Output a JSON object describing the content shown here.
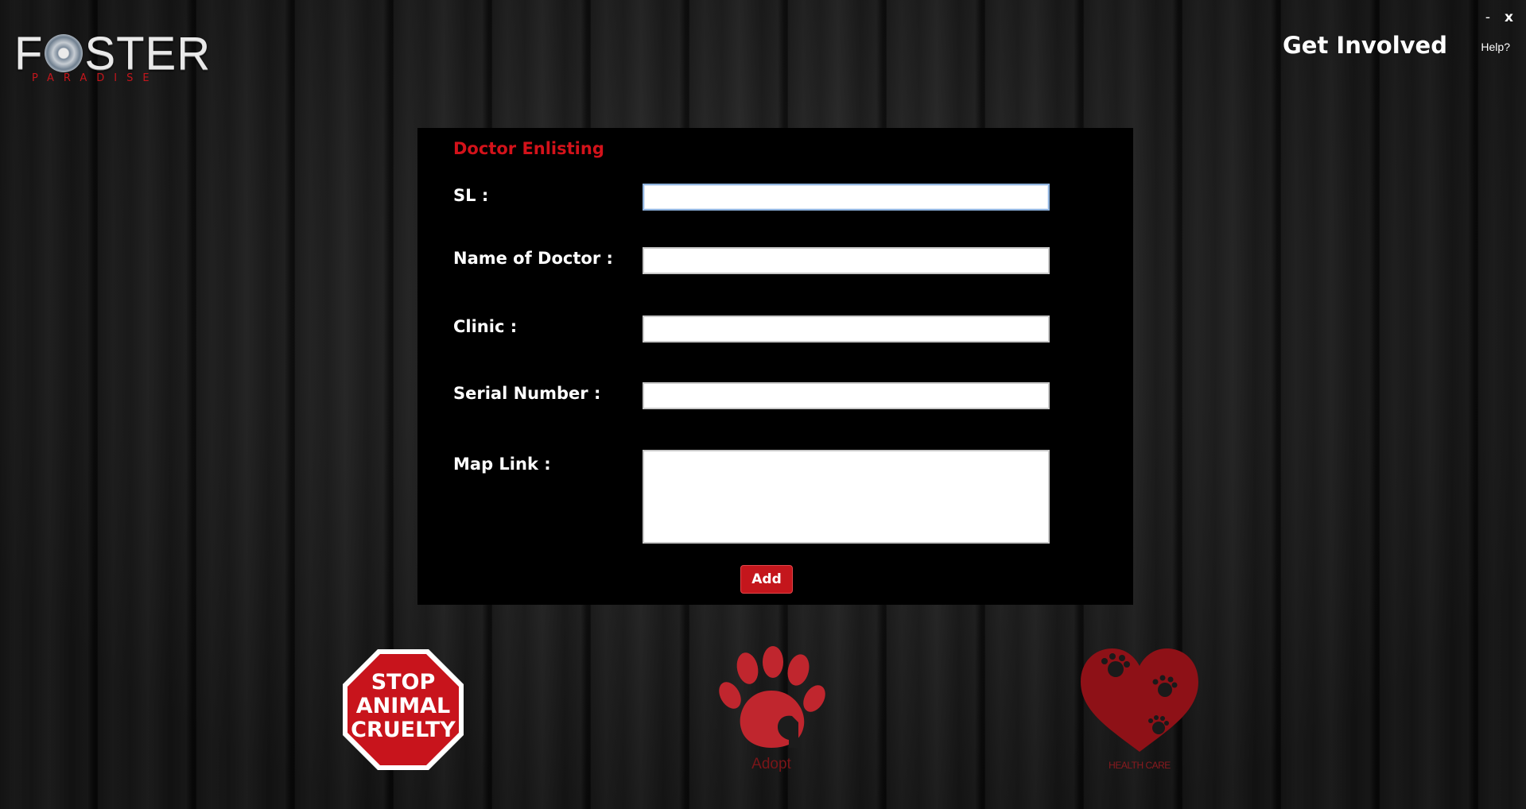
{
  "app": {
    "logo_word_left": "F",
    "logo_word_right": "STER",
    "logo_sub": "PARADISE"
  },
  "window": {
    "minimize": "-",
    "close": "x",
    "help": "Help?"
  },
  "header": {
    "nav_link": "Get Involved"
  },
  "form": {
    "title": "Doctor Enlisting",
    "fields": [
      {
        "label": "SL :",
        "value": ""
      },
      {
        "label": "Name of Doctor :",
        "value": ""
      },
      {
        "label": "Clinic :",
        "value": ""
      },
      {
        "label": "Serial Number :",
        "value": ""
      },
      {
        "label": "Map Link :",
        "value": ""
      }
    ],
    "submit_label": "Add"
  },
  "tiles": {
    "stop_sign_lines": [
      "STOP",
      "ANIMAL",
      "CRUELTY"
    ],
    "adopt_caption": "Adopt",
    "health_caption": "HEALTH CARE"
  },
  "colors": {
    "accent": "#c4161c",
    "panel": "#000000",
    "text": "#ffffff"
  },
  "icons": [
    "stop-sign-icon",
    "paw-dog-icon",
    "paw-heart-icon"
  ]
}
